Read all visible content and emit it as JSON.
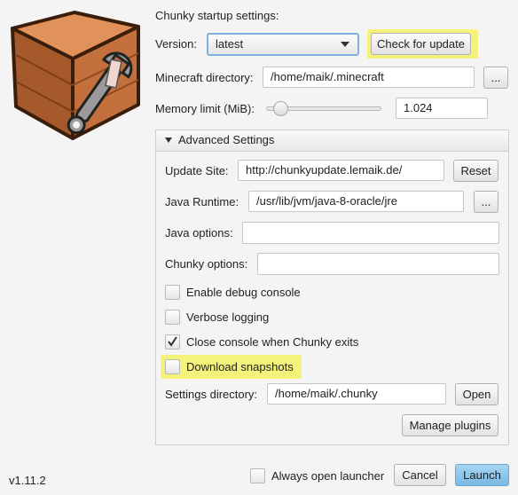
{
  "header": {
    "title": "Chunky startup settings:"
  },
  "version": {
    "label": "Version:",
    "selected": "latest",
    "check_update_label": "Check for update"
  },
  "minecraft": {
    "label": "Minecraft directory:",
    "value": "/home/maik/.minecraft",
    "browse_label": "..."
  },
  "memory": {
    "label": "Memory limit (MiB):",
    "value": "1.024",
    "slider_fraction": 0.07
  },
  "advanced": {
    "title": "Advanced Settings",
    "update_site": {
      "label": "Update Site:",
      "value": "http://chunkyupdate.lemaik.de/",
      "reset_label": "Reset"
    },
    "java_runtime": {
      "label": "Java Runtime:",
      "value": "/usr/lib/jvm/java-8-oracle/jre",
      "browse_label": "..."
    },
    "java_options": {
      "label": "Java options:",
      "value": ""
    },
    "chunky_options": {
      "label": "Chunky options:",
      "value": ""
    },
    "checkboxes": [
      {
        "label": "Enable debug console",
        "checked": false
      },
      {
        "label": "Verbose logging",
        "checked": false
      },
      {
        "label": "Close console when Chunky exits",
        "checked": true
      },
      {
        "label": "Download snapshots",
        "checked": false
      }
    ],
    "settings_dir": {
      "label": "Settings directory:",
      "value": "/home/maik/.chunky",
      "open_label": "Open"
    },
    "manage_plugins_label": "Manage plugins"
  },
  "footer": {
    "version": "v1.11.2",
    "always_open_label": "Always open launcher",
    "cancel_label": "Cancel",
    "launch_label": "Launch"
  },
  "colors": {
    "highlight": "#f4f27a",
    "launch": "#7fbfe6",
    "logo_crate": "#c8703c"
  },
  "icons": {
    "logo": "crate-with-wrench-icon",
    "check": "checkmark-icon",
    "expand": "triangle-down-icon",
    "dropdown": "chevron-down-icon"
  }
}
